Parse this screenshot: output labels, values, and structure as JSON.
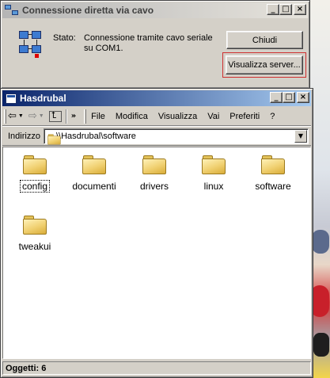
{
  "dialog": {
    "title": "Connessione diretta via cavo",
    "status_label": "Stato:",
    "status_text": "Connessione tramite cavo seriale su COM1.",
    "close_button": "Chiudi",
    "server_button": "Visualizza server..."
  },
  "titlebar_buttons": {
    "minimize": "_",
    "maximize": "□",
    "close": "×"
  },
  "explorer": {
    "title": "Hasdrubal",
    "menu": [
      "File",
      "Modifica",
      "Visualizza",
      "Vai",
      "Preferiti",
      "?"
    ],
    "address_label": "Indirizzo",
    "address_value": "\\\\Hasdrubal\\software",
    "folders": [
      {
        "name": "config"
      },
      {
        "name": "documenti"
      },
      {
        "name": "drivers"
      },
      {
        "name": "linux"
      },
      {
        "name": "software"
      },
      {
        "name": "tweakui"
      }
    ],
    "status": "Oggetti: 6"
  },
  "icons": {
    "back": "back-arrow-icon",
    "forward": "forward-arrow-icon",
    "up": "up-folder-icon",
    "folder": "folder-icon",
    "network": "network-computers-icon"
  },
  "colors": {
    "active_title": "#0a246a",
    "inactive_title": "#b5b5b5",
    "face": "#d4d0c8",
    "highlight_border": "#d03030"
  }
}
